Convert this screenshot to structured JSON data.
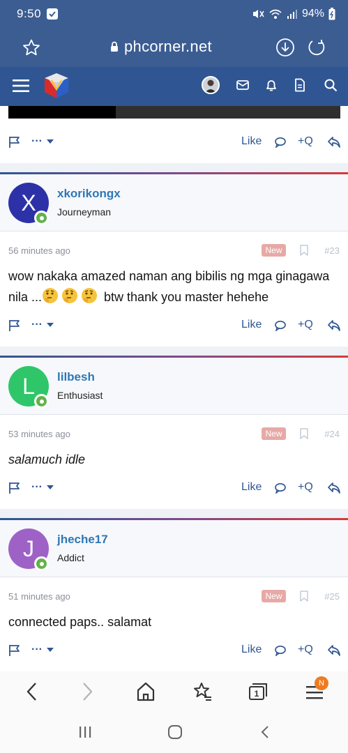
{
  "status": {
    "time": "9:50",
    "battery": "94%"
  },
  "browser": {
    "url": "phcorner.net"
  },
  "posts": [
    {
      "avatar_letter": "X",
      "avatar_color": "#2d31a8",
      "username": "xkorikongx",
      "user_title": "Journeyman",
      "time_ago": "56 minutes ago",
      "badge": "New",
      "post_number": "#23",
      "message_part1": "wow nakaka amazed naman ang bibilis ng mga ginagawa nila ...",
      "message_part2": " btw thank you master hehehe",
      "like_label": "Like",
      "quote_label": "+Q"
    },
    {
      "avatar_letter": "L",
      "avatar_color": "#2fc66a",
      "username": "lilbesh",
      "user_title": "Enthusiast",
      "time_ago": "53 minutes ago",
      "badge": "New",
      "post_number": "#24",
      "message": "salamuch idle",
      "like_label": "Like",
      "quote_label": "+Q"
    },
    {
      "avatar_letter": "J",
      "avatar_color": "#9e62c7",
      "username": "jheche17",
      "user_title": "Addict",
      "time_ago": "51 minutes ago",
      "badge": "New",
      "post_number": "#25",
      "message": "connected paps.. salamat",
      "like_label": "Like",
      "quote_label": "+Q"
    }
  ],
  "prev_post": {
    "like_label": "Like",
    "quote_label": "+Q"
  },
  "bottom_nav": {
    "tabs_count": "1",
    "menu_badge": "N"
  },
  "colors": {
    "accent": "#2f5692",
    "username": "#2f77b5",
    "online": "#63b24a",
    "new_badge": "#e7a9a6"
  }
}
